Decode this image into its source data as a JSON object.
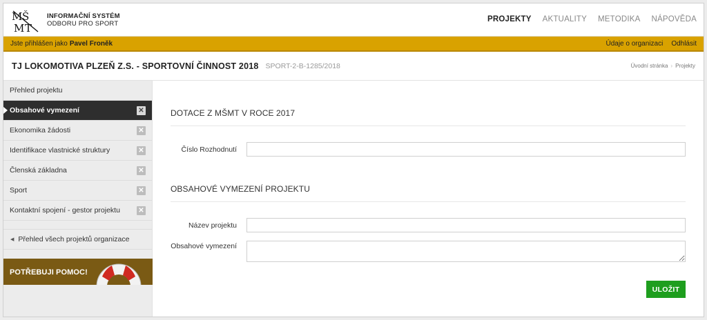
{
  "header": {
    "logo_line1": "INFORMAČNÍ SYSTÉM",
    "logo_line2": "ODBORU PRO SPORT",
    "nav": [
      "PROJEKTY",
      "AKTUALITY",
      "METODIKA",
      "NÁPOVĚDA"
    ],
    "active_nav": "PROJEKTY"
  },
  "userbar": {
    "logged_prefix": "Jste přihlášen jako",
    "user_name": "Pavel Froněk",
    "org_link": "Údaje o organizaci",
    "logout": "Odhlásit"
  },
  "titlebar": {
    "title": "TJ LOKOMOTIVA PLZEŇ Z.S. - SPORTOVNÍ ČINNOST 2018",
    "code": "SPORT-2-B-1285/2018",
    "breadcrumbs": [
      "Úvodní stránka",
      "Projekty"
    ]
  },
  "sidebar": {
    "items": [
      {
        "label": "Přehled projektu",
        "has_close": false
      },
      {
        "label": "Obsahové vymezení",
        "has_close": true,
        "active": true
      },
      {
        "label": "Ekonomika žádosti",
        "has_close": true
      },
      {
        "label": "Identifikace vlastnické struktury",
        "has_close": true
      },
      {
        "label": "Členská základna",
        "has_close": true
      },
      {
        "label": "Sport",
        "has_close": true
      },
      {
        "label": "Kontaktní spojení - gestor projektu",
        "has_close": true
      }
    ],
    "back_link": "Přehled všech projektů organizace",
    "help_label": "POTŘEBUJI POMOC!"
  },
  "main": {
    "section1_title": "DOTACE Z MŠMT V ROCE 2017",
    "decision_label": "Číslo Rozhodnutí",
    "decision_value": "",
    "section2_title": "OBSAHOVÉ VYMEZENÍ PROJEKTU",
    "project_name_label": "Název projektu",
    "project_name_value": "",
    "content_label": "Obsahové vymezení",
    "content_value": "",
    "save_label": "ULOŽIT"
  },
  "colors": {
    "userbar": "#d9a200",
    "active_sidebar": "#2e2e2e",
    "save_button": "#1e9e1e",
    "help_banner": "#7a5a14"
  }
}
